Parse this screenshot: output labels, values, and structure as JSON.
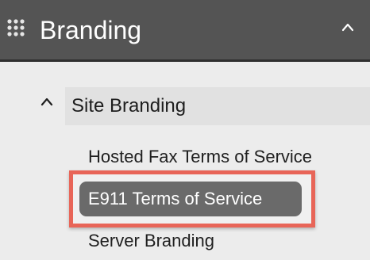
{
  "header": {
    "title": "Branding",
    "menu_icon": "grid-menu-icon",
    "collapse_icon": "chevron-up-icon"
  },
  "section": {
    "label": "Site Branding",
    "collapse_icon": "chevron-up-icon"
  },
  "items": [
    {
      "label": "Hosted Fax Terms of Service",
      "selected": false
    },
    {
      "label": "E911 Terms of Service",
      "selected": true
    },
    {
      "label": "Server Branding",
      "selected": false
    }
  ],
  "colors": {
    "header_bg": "#545454",
    "page_bg": "#ececec",
    "section_bg": "#e1e1e1",
    "selected_bg": "#6a6a6a",
    "highlight_border": "#e86558"
  }
}
